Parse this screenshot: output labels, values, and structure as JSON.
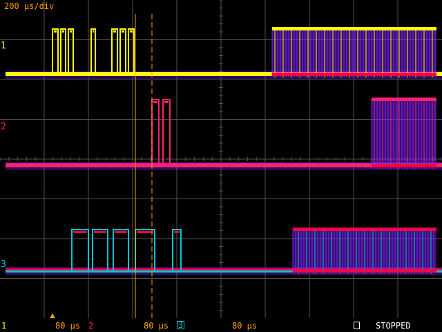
{
  "header": {
    "timebase": "200 µs/div"
  },
  "colors": {
    "ch1": "#ffff00",
    "ch2": "#ff2070",
    "ch3": "#00c8d8",
    "grid": "#555555",
    "persistence_hot": "#ff0040",
    "persistence_cool": "#8020ff",
    "cursor": "#ffa000"
  },
  "channels": [
    {
      "label": "1"
    },
    {
      "label": "2"
    },
    {
      "label": "3"
    }
  ],
  "status_bar": {
    "ch1_label": "1",
    "ch1_scale": "80 µs",
    "ch2_label": "2",
    "ch2_scale": "80 µs",
    "ch3_label": "3",
    "ch3_scale": "80 µs",
    "run_icon": "square-outline-icon",
    "state": "STOPPED"
  }
}
